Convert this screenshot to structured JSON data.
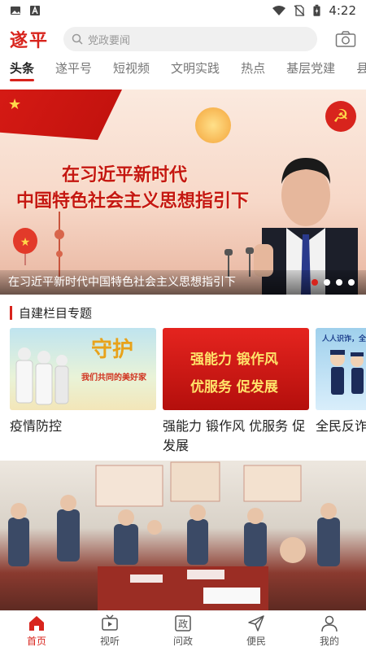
{
  "status_bar": {
    "time": "4:22",
    "icons": [
      "image-icon",
      "text-app-icon",
      "wifi-icon",
      "no-sim-icon",
      "battery-charging-icon"
    ]
  },
  "header": {
    "logo_text": "遂平",
    "search_placeholder": "党政要闻",
    "camera_icon": "camera-icon"
  },
  "tabs": [
    {
      "label": "头条",
      "active": true
    },
    {
      "label": "遂平号",
      "active": false
    },
    {
      "label": "短视频",
      "active": false
    },
    {
      "label": "文明实践",
      "active": false
    },
    {
      "label": "热点",
      "active": false
    },
    {
      "label": "基层党建",
      "active": false
    },
    {
      "label": "县直",
      "active": false
    }
  ],
  "banner": {
    "headline_line1": "在习近平新时代",
    "headline_line2": "中国特色社会主义思想指引下",
    "caption": "在习近平新时代中国特色社会主义思想指引下",
    "slide_count": 4,
    "active_slide": 1
  },
  "section": {
    "title": "自建栏目专题"
  },
  "cards": [
    {
      "label": "疫情防控",
      "image_text": "守护",
      "image_subtext": "我们共同的美好家"
    },
    {
      "label": "强能力 锻作风 优服务 促发展",
      "image_text_1": "强能力 锻作风",
      "image_text_2": "优服务 促发展"
    },
    {
      "label": "全民反诈",
      "image_text": "人人识诈，全民"
    }
  ],
  "bottom_nav": [
    {
      "label": "首页",
      "icon": "home-icon",
      "active": true
    },
    {
      "label": "视听",
      "icon": "tv-icon",
      "active": false
    },
    {
      "label": "问政",
      "icon": "inquiry-icon",
      "icon_text": "政",
      "active": false
    },
    {
      "label": "便民",
      "icon": "send-icon",
      "active": false
    },
    {
      "label": "我的",
      "icon": "user-icon",
      "active": false
    }
  ],
  "colors": {
    "accent": "#d8241d",
    "text": "#222222",
    "muted": "#777777"
  }
}
